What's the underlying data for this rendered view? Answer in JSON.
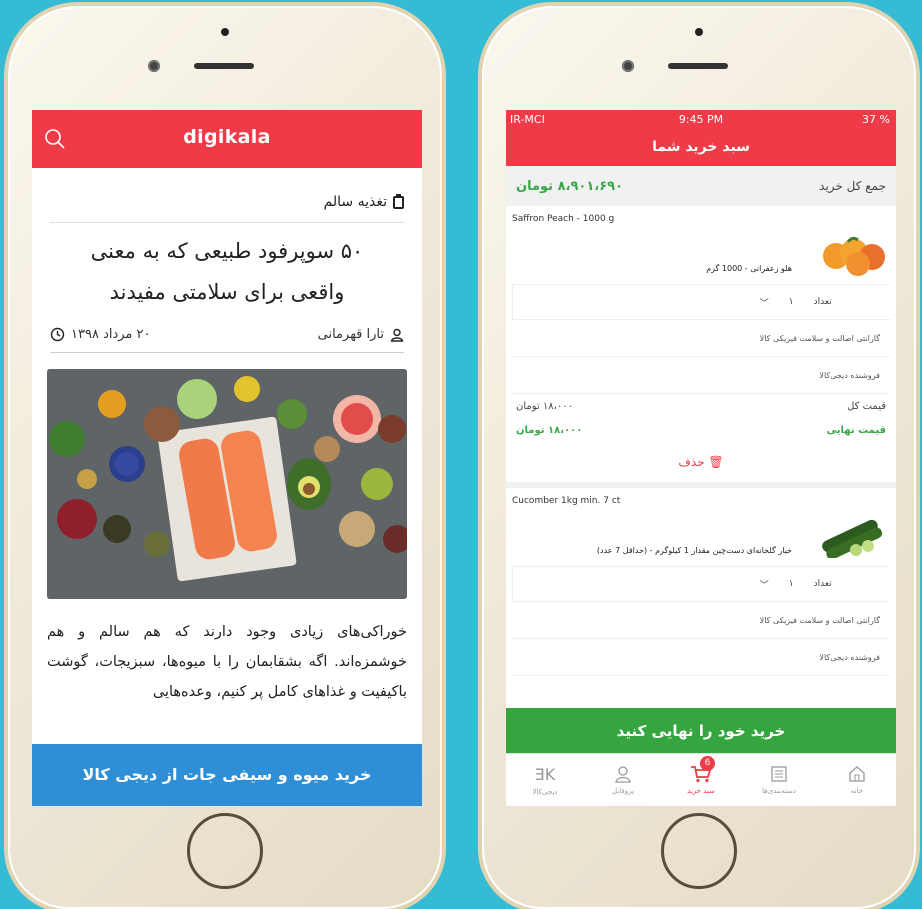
{
  "left": {
    "brand": "digikala",
    "category": "تغذیه سالم",
    "title_line1": "۵۰ سوپرفود طبیعی که به معنی",
    "title_line2": "واقعی برای سلامتی مفیدند",
    "author": "تارا قهرمانی",
    "date": "۲۰ مرداد ۱۳۹۸",
    "paragraph": "خوراکی‌های زیادی وجود دارند که هم سالم و هم خوشمزه‌اند. اگه بشقابمان را با میوه‌ها، سبزیجات، گوشت باکیفیت و غذاهای کامل پر کنیم، وعده‌هایی",
    "cta": "خرید میوه و سیفی جات از دیجی کالا"
  },
  "right": {
    "status": {
      "carrier": "IR-MCI",
      "time": "9:45 PM",
      "battery": "37 %"
    },
    "header_title": "سبد خرید شما",
    "total_label": "جمع کل خرید",
    "total_amount": "۸،۹۰۱،۶۹۰ تومان",
    "items": [
      {
        "name_en": "Saffron Peach - 1000 g",
        "name_fa": "هلو زعفرانی - 1000 گرم",
        "qty_label": "تعداد",
        "qty": "۱",
        "guarantee": "گارانتی اصالت و سلامت فیزیکی کالا",
        "seller": "فروشنده دیجی‌کالا",
        "price_label": "قیمت کل",
        "price": "۱۸،۰۰۰ تومان",
        "final_label": "قیمت نهایی",
        "final_price": "۱۸،۰۰۰ تومان",
        "delete": "حذف"
      },
      {
        "name_en": "Cucomber 1kg min. 7 ct",
        "name_fa": "خیار گلخانه‌ای دست‌چین مقدار 1 کیلوگرم - (حداقل 7 عدد)",
        "qty_label": "تعداد",
        "qty": "۱",
        "guarantee": "گارانتی اصالت و سلامت فیزیکی کالا",
        "seller": "فروشنده دیجی‌کالا"
      }
    ],
    "checkout": "خرید خود را نهایی کنید",
    "tabs": [
      "خانه",
      "دسته‌بندی‌ها",
      "سبد خرید",
      "پروفایل",
      "دیجی‌کالا"
    ],
    "cart_badge": "6"
  },
  "colors": {
    "brand_red": "#ef3a48",
    "cta_blue": "#2e8fd6",
    "cta_green": "#35a63f",
    "price_green": "#3ca64a",
    "background": "#35bcd4"
  }
}
